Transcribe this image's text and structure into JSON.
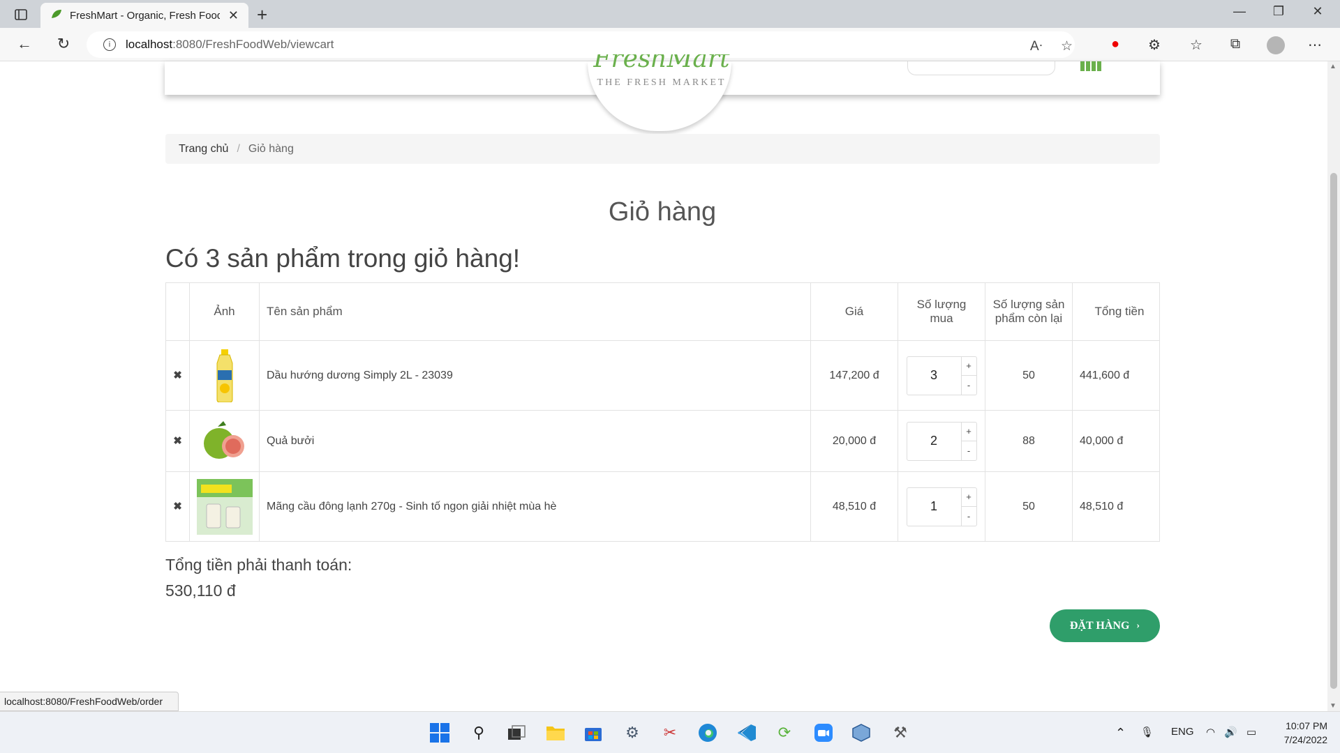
{
  "browser": {
    "tab_title": "FreshMart - Organic, Fresh Food",
    "url_host": "localhost",
    "url_path": ":8080/FreshFoodWeb/viewcart",
    "status_url": "localhost:8080/FreshFoodWeb/order"
  },
  "header": {
    "logo_tagline": "THE FRESH MARKET",
    "logo_script": "FreshMart"
  },
  "breadcrumb": {
    "home": "Trang chủ",
    "separator": "/",
    "current": "Giỏ hàng"
  },
  "page": {
    "title": "Giỏ hàng",
    "cart_count_text": "Có 3 sản phẩm trong giỏ hàng!"
  },
  "table": {
    "headers": {
      "image": "Ảnh",
      "name": "Tên sản phẩm",
      "price": "Giá",
      "qty": "Số lượng mua",
      "stock": "Số lượng sản phẩm còn lại",
      "total": "Tổng tiền"
    },
    "rows": [
      {
        "name": "Dầu hướng dương Simply 2L - 23039",
        "price": "147,200 đ",
        "qty": "3",
        "stock": "50",
        "total": "441,600 đ"
      },
      {
        "name": "Quả bưởi",
        "price": "20,000 đ",
        "qty": "2",
        "stock": "88",
        "total": "40,000 đ"
      },
      {
        "name": "Mãng cầu đông lạnh 270g - Sinh tố ngon giải nhiệt mùa hè",
        "price": "48,510 đ",
        "qty": "1",
        "stock": "50",
        "total": "48,510 đ"
      }
    ],
    "remove_symbol": "✖",
    "plus": "+",
    "minus": "-"
  },
  "summary": {
    "label": "Tổng tiền phải thanh toán:",
    "value": "530,110 đ"
  },
  "actions": {
    "order_label": "ĐẶT HÀNG",
    "order_chevron": "›"
  },
  "taskbar": {
    "lang": "ENG",
    "time": "10:07 PM",
    "date": "7/24/2022"
  },
  "colors": {
    "brand_green": "#6ab04c",
    "button_green": "#2f9e6a"
  }
}
